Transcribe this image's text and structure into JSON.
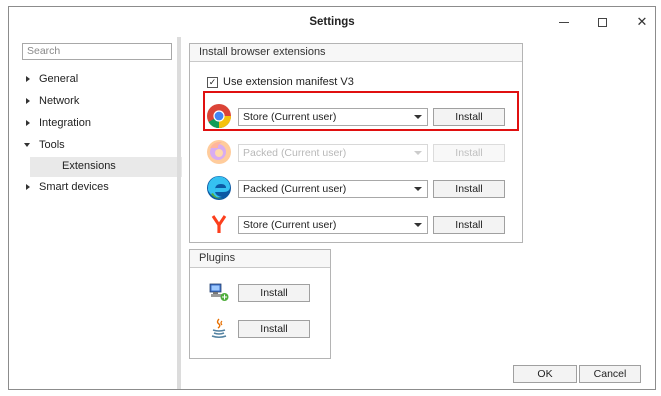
{
  "window": {
    "title": "Settings",
    "minimize_label": "—",
    "close_label": "✕"
  },
  "sidebar": {
    "search_placeholder": "Search",
    "items": [
      {
        "label": "General",
        "expanded": false
      },
      {
        "label": "Network",
        "expanded": false
      },
      {
        "label": "Integration",
        "expanded": false
      },
      {
        "label": "Tools",
        "expanded": true
      },
      {
        "label": "Extensions",
        "selected": true
      },
      {
        "label": "Smart devices",
        "expanded": false
      }
    ]
  },
  "extensions_group": {
    "title": "Install browser extensions",
    "manifest_checkbox": {
      "label": "Use extension manifest V3",
      "checked": true,
      "mark": "✓"
    },
    "browsers": [
      {
        "icon": "chrome-icon",
        "mode": "Store (Current user)",
        "install_label": "Install",
        "enabled": true,
        "highlighted": true
      },
      {
        "icon": "firefox-icon",
        "mode": "Packed (Current user)",
        "install_label": "Install",
        "enabled": false
      },
      {
        "icon": "edge-icon",
        "mode": "Packed (Current user)",
        "install_label": "Install",
        "enabled": true
      },
      {
        "icon": "yandex-icon",
        "mode": "Store (Current user)",
        "install_label": "Install",
        "enabled": true
      }
    ],
    "highlight_color": "#e01010"
  },
  "plugins_group": {
    "title": "Plugins",
    "plugins": [
      {
        "icon": "network-plugin-icon",
        "install_label": "Install"
      },
      {
        "icon": "java-icon",
        "install_label": "Install"
      }
    ]
  },
  "footer": {
    "ok_label": "OK",
    "cancel_label": "Cancel"
  }
}
